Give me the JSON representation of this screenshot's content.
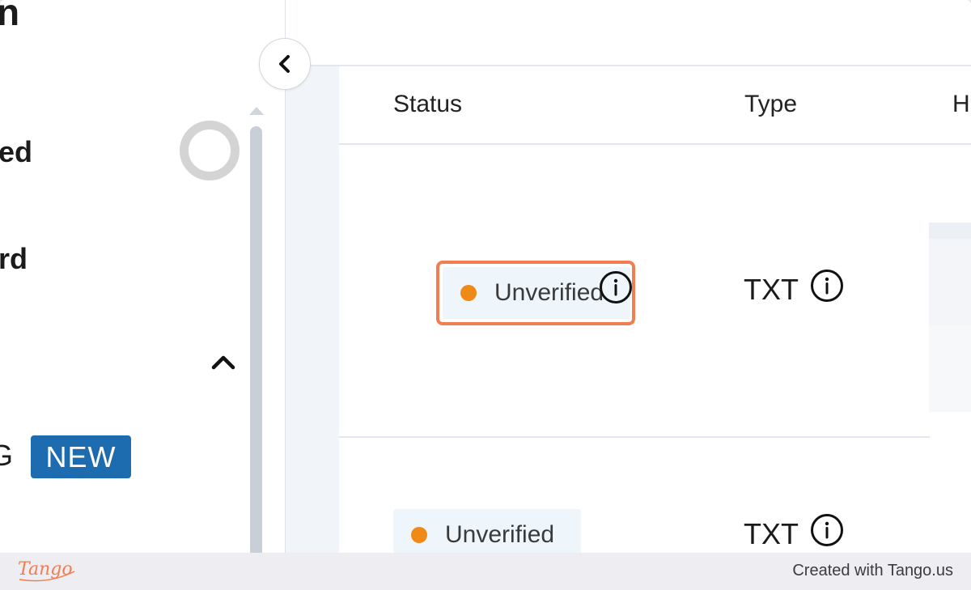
{
  "sidebar": {
    "title_fragment": "n",
    "items": [
      {
        "label": "ed"
      },
      {
        "label": "rd"
      }
    ],
    "group_fragment": "G",
    "new_badge": "NEW"
  },
  "table": {
    "headers": [
      "Status",
      "Type",
      "H"
    ],
    "rows": [
      {
        "status": "Unverified",
        "type": "TXT"
      },
      {
        "status": "Unverified",
        "type": "TXT"
      }
    ]
  },
  "colors": {
    "status_dot": "#ef8a17",
    "highlight_border": "#f27d50",
    "badge_bg": "#1e6cb0"
  },
  "icons": [
    "chevron-left-icon",
    "chevron-up-icon",
    "info-icon",
    "spinner-ring-icon"
  ],
  "footer": {
    "logo": "Tango",
    "credit": "Created with Tango.us"
  }
}
